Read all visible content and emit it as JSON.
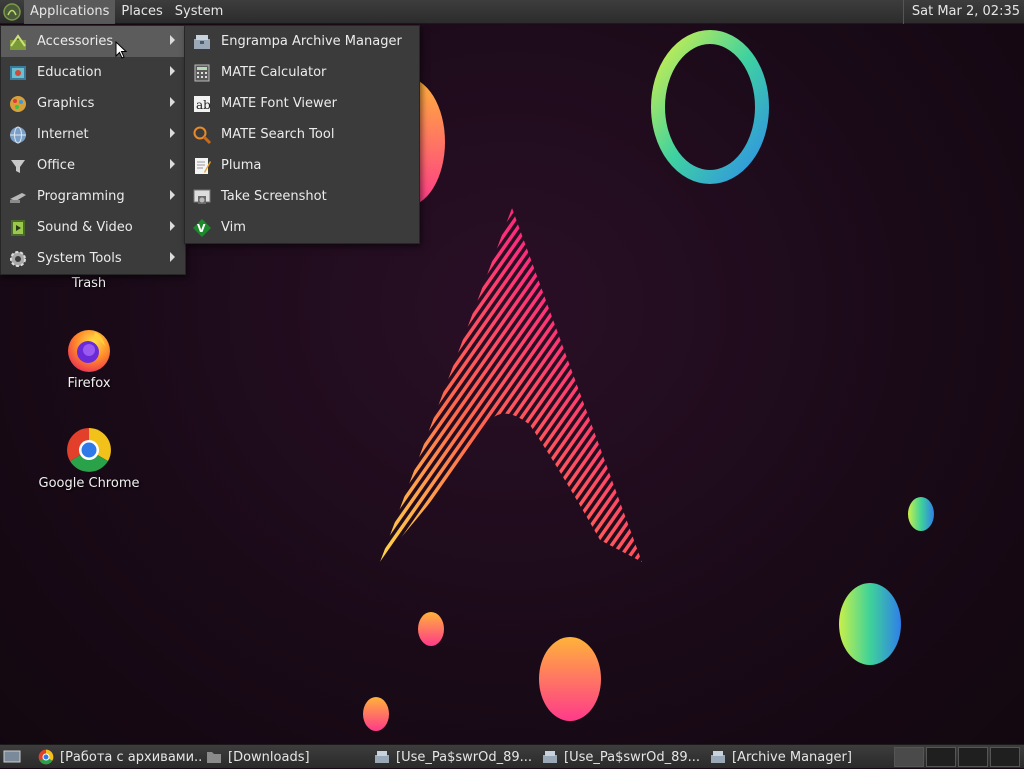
{
  "top_panel": {
    "menus": [
      "Applications",
      "Places",
      "System"
    ],
    "clock": "Sat Mar  2, 02:35"
  },
  "app_menu": {
    "categories": [
      {
        "label": "Accessories",
        "icon": "accessories-icon"
      },
      {
        "label": "Education",
        "icon": "education-icon"
      },
      {
        "label": "Graphics",
        "icon": "graphics-icon"
      },
      {
        "label": "Internet",
        "icon": "internet-icon"
      },
      {
        "label": "Office",
        "icon": "office-icon"
      },
      {
        "label": "Programming",
        "icon": "programming-icon"
      },
      {
        "label": "Sound & Video",
        "icon": "sound-video-icon"
      },
      {
        "label": "System Tools",
        "icon": "system-tools-icon"
      }
    ],
    "selected": "Accessories"
  },
  "accessories_menu": {
    "items": [
      {
        "label": "Engrampa Archive Manager",
        "icon": "archive-manager-icon"
      },
      {
        "label": "MATE Calculator",
        "icon": "calculator-icon"
      },
      {
        "label": "MATE Font Viewer",
        "icon": "font-viewer-icon"
      },
      {
        "label": "MATE Search Tool",
        "icon": "search-tool-icon"
      },
      {
        "label": "Pluma",
        "icon": "text-editor-icon"
      },
      {
        "label": "Take Screenshot",
        "icon": "screenshot-icon"
      },
      {
        "label": "Vim",
        "icon": "vim-icon"
      }
    ]
  },
  "desktop": {
    "icons": [
      {
        "label": "Trash",
        "icon": "trash-icon"
      },
      {
        "label": "Firefox",
        "icon": "firefox-icon"
      },
      {
        "label": "Google Chrome",
        "icon": "chrome-icon"
      }
    ]
  },
  "taskbar": {
    "tasks": [
      {
        "label": "[Работа с архивами...",
        "icon": "chrome-icon"
      },
      {
        "label": "[Downloads]",
        "icon": "folder-icon"
      },
      {
        "label": "[Use_Pa$swrOd_89...",
        "icon": "archive-manager-icon"
      },
      {
        "label": "[Use_Pa$swrOd_89...",
        "icon": "archive-manager-icon"
      },
      {
        "label": "[Archive Manager]",
        "icon": "archive-manager-icon"
      }
    ]
  },
  "colors": {
    "panel_bg": "#2c2c2c",
    "menu_bg": "#3b3b3b",
    "menu_highlight": "#5c5c5c",
    "desktop_bg": "#1a0a18"
  }
}
